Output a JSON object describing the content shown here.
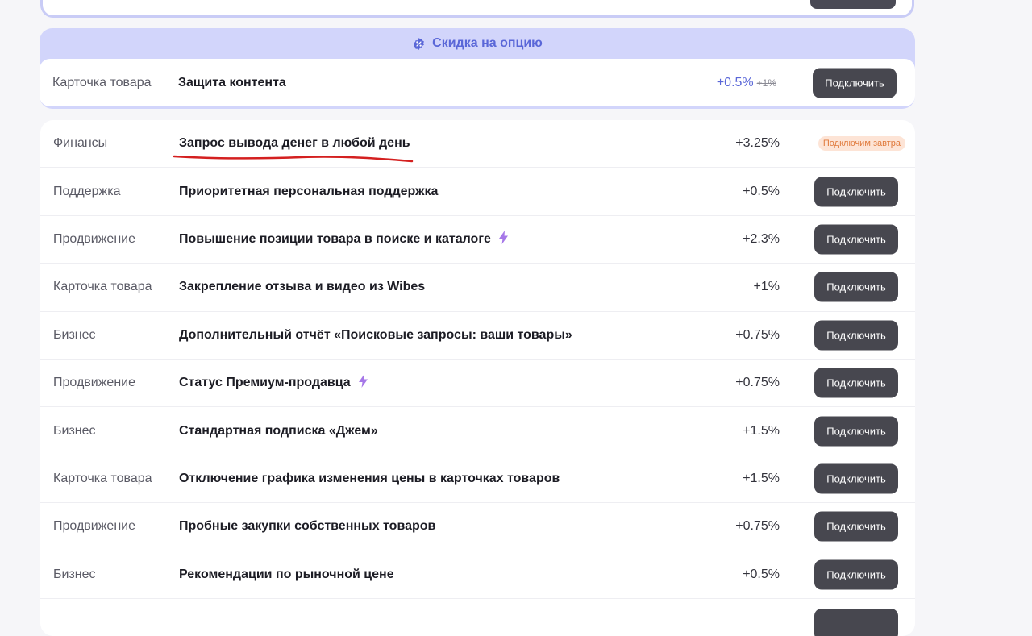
{
  "discount": {
    "header": "Скидка на опцию",
    "row": {
      "category": "Карточка товара",
      "name": "Защита контента",
      "pct_new": "+0.5%",
      "pct_old": "+1%",
      "button": "Подключить"
    }
  },
  "rows": [
    {
      "category": "Финансы",
      "name": "Запрос вывода денег в любой день",
      "pct": "+3.25%",
      "status": "Подключим завтра"
    },
    {
      "category": "Поддержка",
      "name": "Приоритетная персональная поддержка",
      "pct": "+0.5%",
      "button": "Подключить"
    },
    {
      "category": "Продвижение",
      "name": "Повышение позиции товара в поиске и каталоге",
      "pct": "+2.3%",
      "button": "Подключить"
    },
    {
      "category": "Карточка товара",
      "name": "Закрепление отзыва и видео из Wibes",
      "pct": "+1%",
      "button": "Подключить"
    },
    {
      "category": "Бизнес",
      "name": "Дополнительный отчёт «Поисковые запросы: ваши товары»",
      "pct": "+0.75%",
      "button": "Подключить"
    },
    {
      "category": "Продвижение",
      "name": "Статус Премиум-продавца",
      "pct": "+0.75%",
      "button": "Подключить"
    },
    {
      "category": "Бизнес",
      "name": "Стандартная подписка «Джем»",
      "pct": "+1.5%",
      "button": "Подключить"
    },
    {
      "category": "Карточка товара",
      "name": "Отключение графика изменения цены в карточках товаров",
      "pct": "+1.5%",
      "button": "Подключить"
    },
    {
      "category": "Продвижение",
      "name": "Пробные закупки собственных товаров",
      "pct": "+0.75%",
      "button": "Подключить"
    },
    {
      "category": "Бизнес",
      "name": "Рекомендации по рыночной цене",
      "pct": "+0.5%",
      "button": "Подключить"
    }
  ],
  "colors": {
    "accent": "#5a67d8",
    "discount_bg": "#d2d5fb",
    "button_bg": "#47474f",
    "pill_bg": "#fde4d6",
    "pill_text": "#e07a3c",
    "bolt": "#a678e8",
    "annotation": "#d42020"
  },
  "icons": {
    "discount": "discount-badge-icon",
    "boost": "lightning-icon"
  }
}
